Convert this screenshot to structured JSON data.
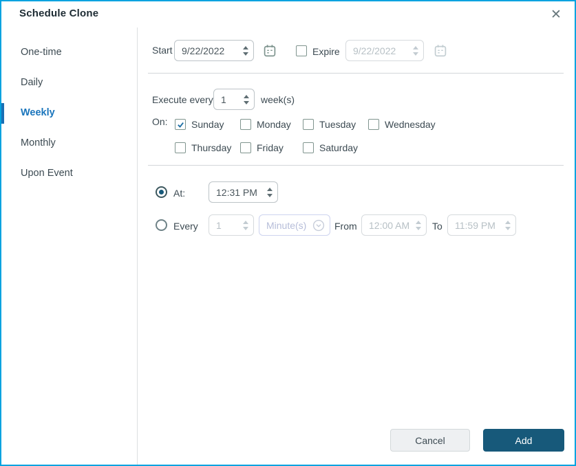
{
  "window": {
    "title": "Schedule Clone",
    "close_icon": "✕"
  },
  "colors": {
    "window_border": "#00a3e0",
    "selected_nav_blue": "#1a75bc",
    "primary_button": "#17597a",
    "check_blue": "#1c6ea4"
  },
  "sidebar": {
    "selected": "Weekly",
    "items": [
      {
        "label": "One-time"
      },
      {
        "label": "Daily"
      },
      {
        "label": "Weekly"
      },
      {
        "label": "Monthly"
      },
      {
        "label": "Upon Event"
      }
    ]
  },
  "schedule": {
    "start": {
      "label": "Start",
      "value": "9/22/2022"
    },
    "expire": {
      "label": "Expire",
      "checked": false,
      "value": "9/22/2022"
    },
    "execute": {
      "label": "Execute every",
      "value": "1",
      "unit": "week(s)"
    },
    "on": {
      "label": "On:",
      "days": [
        {
          "label": "Sunday",
          "checked": true
        },
        {
          "label": "Monday",
          "checked": false
        },
        {
          "label": "Tuesday",
          "checked": false
        },
        {
          "label": "Wednesday",
          "checked": false
        },
        {
          "label": "Thursday",
          "checked": false
        },
        {
          "label": "Friday",
          "checked": false
        },
        {
          "label": "Saturday",
          "checked": false
        }
      ]
    },
    "at": {
      "label": "At:",
      "selected": true,
      "value": "12:31 PM"
    },
    "every": {
      "label": "Every",
      "selected": false,
      "interval": "1",
      "unit": "Minute(s)",
      "from_label": "From",
      "from_value": "12:00 AM",
      "to_label": "To",
      "to_value": "11:59 PM"
    }
  },
  "footer": {
    "cancel_label": "Cancel",
    "add_label": "Add"
  }
}
